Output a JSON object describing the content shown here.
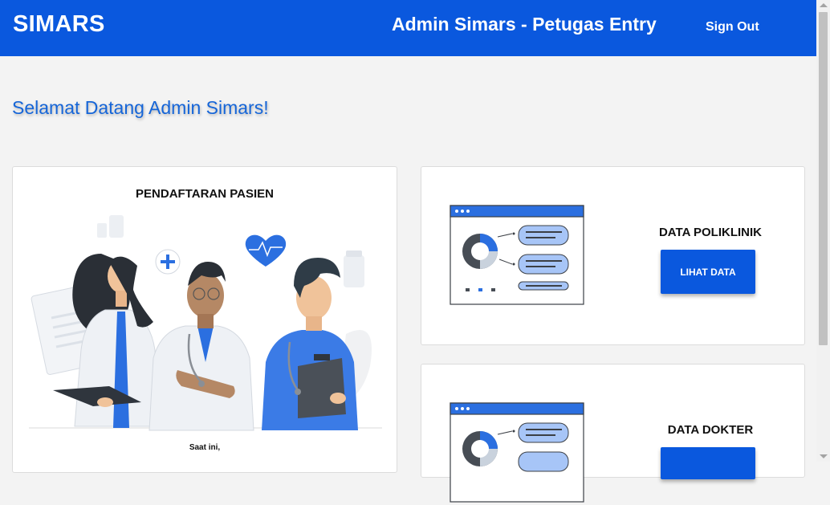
{
  "header": {
    "brand": "SIMARS",
    "title": "Admin Simars - Petugas Entry",
    "signout_label": "Sign Out"
  },
  "welcome": "Selamat Datang Admin Simars!",
  "cards": {
    "pasien": {
      "title": "PENDAFTARAN PASIEN",
      "footer_text": "Saat ini,"
    },
    "poliklinik": {
      "title": "DATA POLIKLINIK",
      "button_label": "LIHAT DATA"
    },
    "dokter": {
      "title": "DATA DOKTER",
      "button_label": ""
    }
  },
  "colors": {
    "primary": "#0a58de",
    "welcome": "#1565d8",
    "background": "#f3f3f3"
  }
}
